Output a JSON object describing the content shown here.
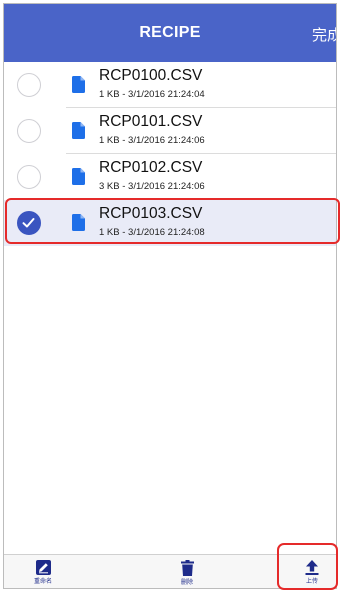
{
  "header": {
    "title": "RECIPE",
    "done_label": "完成"
  },
  "files": [
    {
      "name": "RCP0100.CSV",
      "meta": "1 KB - 3/1/2016 21:24:04",
      "selected": false
    },
    {
      "name": "RCP0101.CSV",
      "meta": "1 KB - 3/1/2016 21:24:06",
      "selected": false
    },
    {
      "name": "RCP0102.CSV",
      "meta": "3 KB - 3/1/2016 21:24:06",
      "selected": false
    },
    {
      "name": "RCP0103.CSV",
      "meta": "1 KB - 3/1/2016 21:24:08",
      "selected": true
    }
  ],
  "toolbar": {
    "rename_label": "重命名",
    "delete_label": "删除",
    "upload_label": "上传"
  },
  "colors": {
    "nav_bar": "#4a64c8",
    "accent": "#3a55c0",
    "highlight_outline": "#e52a2a"
  },
  "icons": {
    "rename": "edit-icon",
    "delete": "trash-icon",
    "upload": "upload-icon",
    "file": "document-icon",
    "check": "checkmark-icon"
  }
}
